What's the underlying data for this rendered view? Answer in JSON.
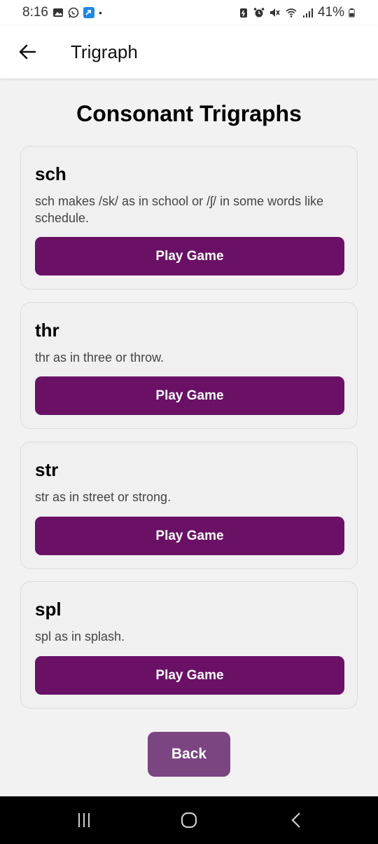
{
  "status_bar": {
    "time": "8:16",
    "dot": "•",
    "battery": "41%",
    "left_icons": [
      "gallery-icon",
      "whatsapp-icon",
      "app-notification-icon"
    ],
    "right_icons": [
      "battery-saver-icon",
      "alarm-icon",
      "mute-icon",
      "wifi-icon",
      "signal-icon",
      "battery-icon"
    ]
  },
  "app_bar": {
    "title": "Trigraph",
    "back_icon": "arrow-left-icon"
  },
  "page": {
    "title": "Consonant Trigraphs"
  },
  "cards": [
    {
      "title": "sch",
      "description": "sch makes /sk/ as in school or /ʃ/ in some words like schedule.",
      "button": "Play Game"
    },
    {
      "title": "thr",
      "description": "thr as in three or throw.",
      "button": "Play Game"
    },
    {
      "title": "str",
      "description": "str as in street or strong.",
      "button": "Play Game"
    },
    {
      "title": "spl",
      "description": "spl as in splash.",
      "button": "Play Game"
    }
  ],
  "back_button": "Back",
  "nav_bar": {
    "icons": [
      "recent-apps-icon",
      "home-icon",
      "back-nav-icon"
    ]
  },
  "colors": {
    "primary": "#6a1166",
    "back_button": "#7b4582",
    "background": "#f2f2f2"
  }
}
